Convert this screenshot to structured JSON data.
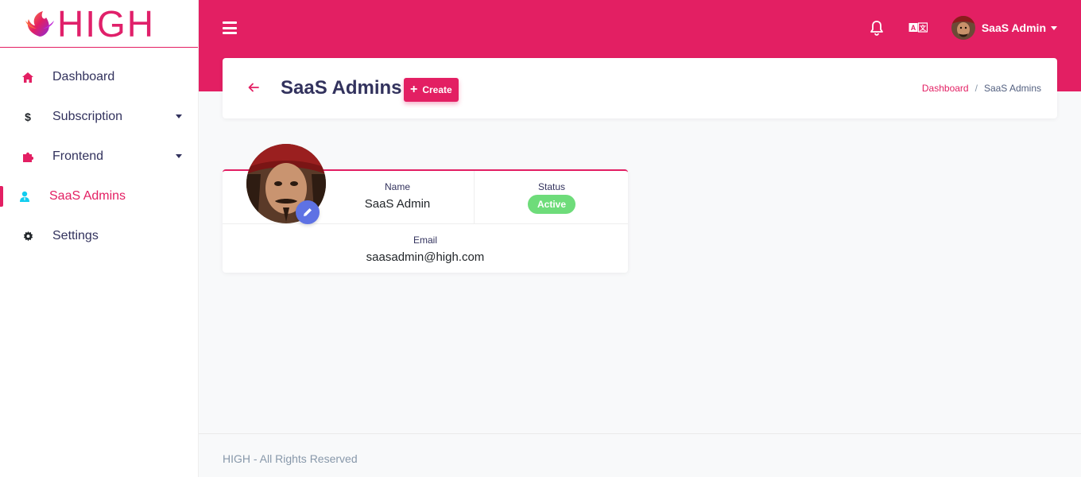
{
  "brand": {
    "name": "HIGH",
    "accent": "#e31f63"
  },
  "sidebar": {
    "items": [
      {
        "label": "Dashboard",
        "icon": "home-icon"
      },
      {
        "label": "Subscription",
        "icon": "dollar-icon",
        "has_submenu": true
      },
      {
        "label": "Frontend",
        "icon": "puzzle-icon",
        "has_submenu": true
      },
      {
        "label": "SaaS Admins",
        "icon": "user-tie-icon",
        "active": true
      },
      {
        "label": "Settings",
        "icon": "gear-icon"
      }
    ]
  },
  "topbar": {
    "icons": [
      "menu-icon",
      "bell-icon",
      "language-icon"
    ],
    "user_name": "SaaS Admin"
  },
  "header": {
    "title": "SaaS Admins",
    "create_label": "Create",
    "breadcrumb": {
      "link": "Dashboard",
      "separator": "/",
      "current": "SaaS Admins"
    }
  },
  "profile": {
    "name_label": "Name",
    "name_value": "SaaS Admin",
    "status_label": "Status",
    "status_value": "Active",
    "email_label": "Email",
    "email_value": "saasadmin@high.com",
    "status_color": "#6edc7a",
    "edit_color": "#5e72e4"
  },
  "footer": {
    "text": "HIGH - All Rights Reserved"
  }
}
